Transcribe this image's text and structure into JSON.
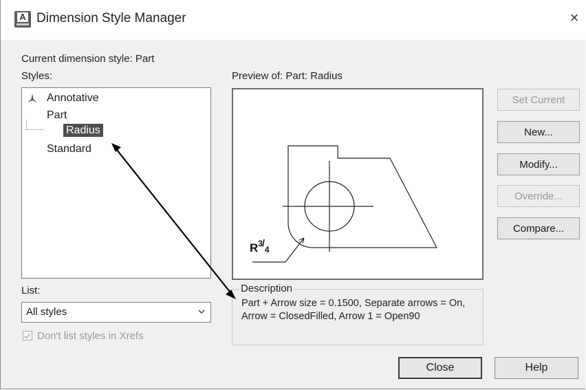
{
  "window": {
    "title": "Dimension Style Manager",
    "close_glyph": "×"
  },
  "current_style": "Current dimension style: Part",
  "styles_label": "Styles:",
  "styles_tree": {
    "items": [
      {
        "label": "Annotative",
        "icon": "annotative-icon"
      },
      {
        "label": "Part"
      },
      {
        "label": "Radius",
        "selected": true
      },
      {
        "label": "Standard"
      }
    ]
  },
  "preview": {
    "label": "Preview of: Part: Radius",
    "dim_text_main": "R",
    "dim_text_sup": "3",
    "dim_text_sub": "4"
  },
  "buttons": {
    "set_current": "Set Current",
    "new": "New...",
    "modify": "Modify...",
    "override": "Override...",
    "compare": "Compare..."
  },
  "list": {
    "label": "List:",
    "selected": "All styles"
  },
  "xref_checkbox": {
    "label": "Don't list styles in Xrefs",
    "checked": true,
    "enabled": false
  },
  "description": {
    "label": "Description",
    "text": "Part + Arrow size = 0.1500, Separate arrows = On, Arrow = ClosedFilled, Arrow 1 = Open90"
  },
  "footer": {
    "close": "Close",
    "help": "Help"
  },
  "colors": {
    "selection": "#4d4d4d",
    "disabled_text": "#9a9a9a"
  }
}
